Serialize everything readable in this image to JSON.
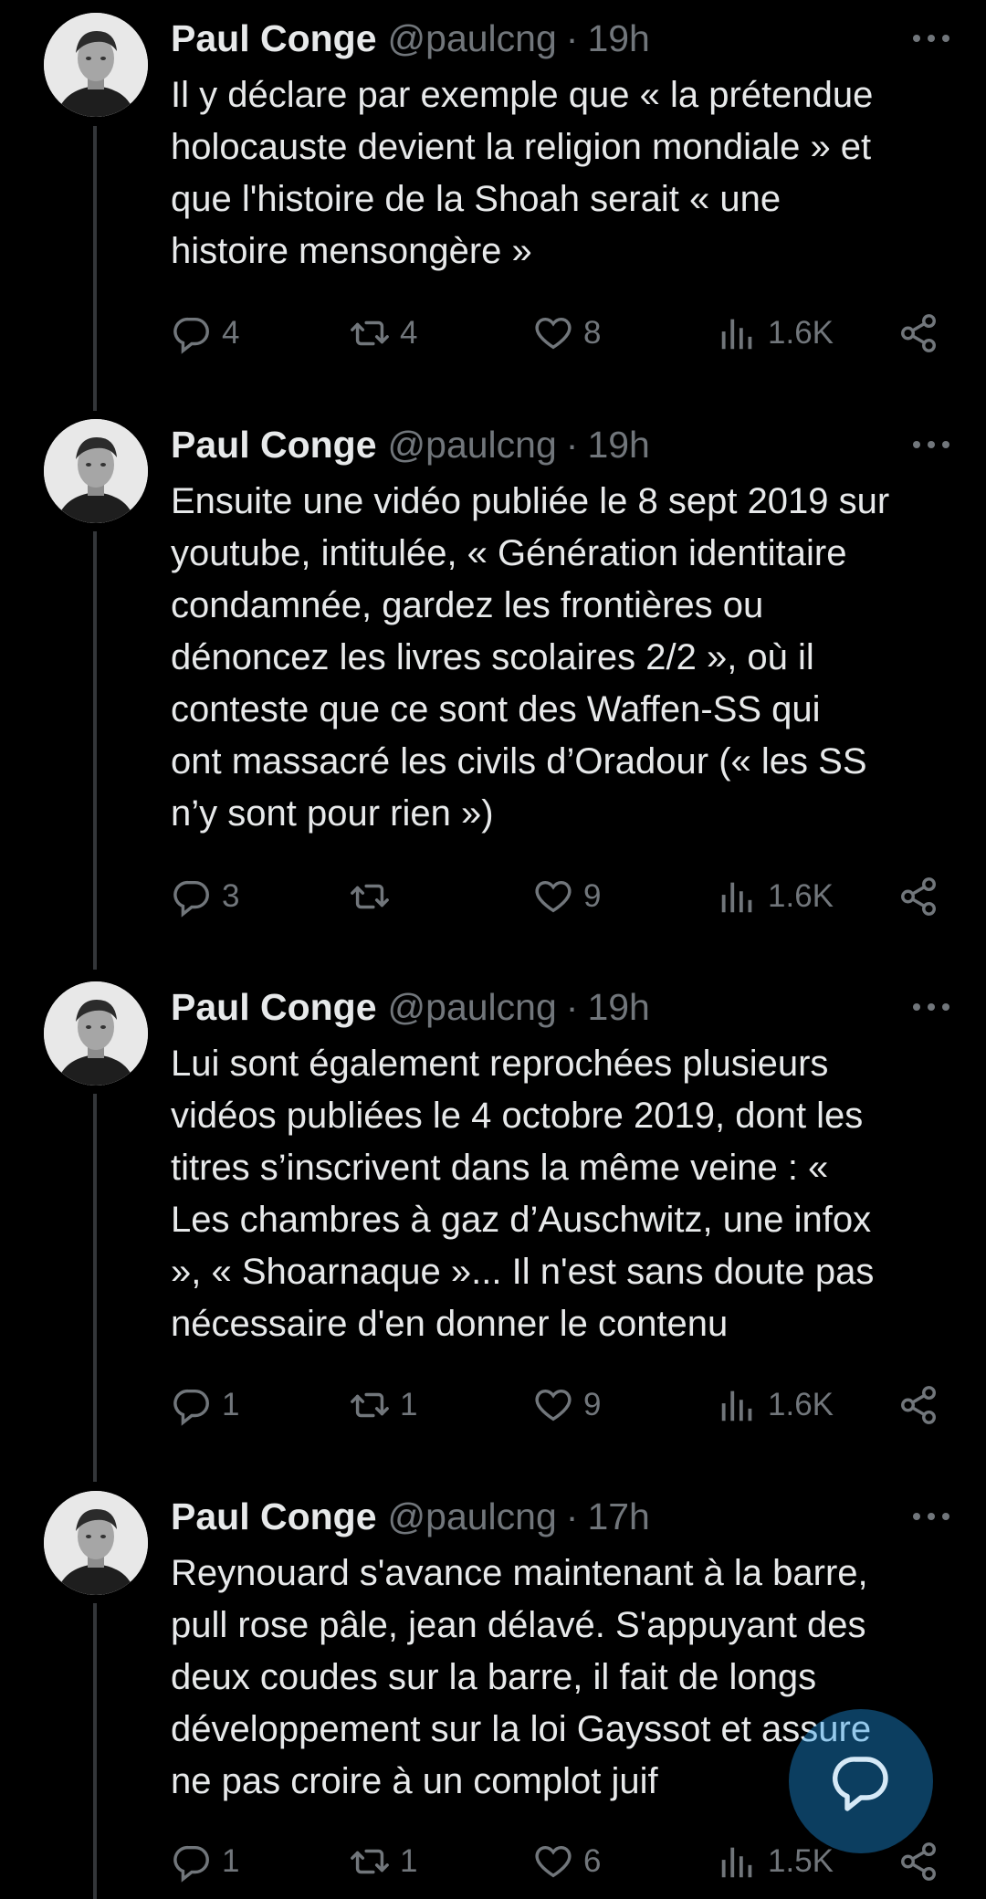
{
  "tweets": [
    {
      "name": "Paul Conge",
      "handle": "@paulcng",
      "sep": "·",
      "time": "19h",
      "text": "Il y déclare par exemple que « la prétendue\nholocauste devient la religion mondiale » et\nque l'histoire de la Shoah serait « une\nhistoire mensongère »",
      "replies": "4",
      "retweets": "4",
      "likes": "8",
      "views": "1.6K"
    },
    {
      "name": "Paul Conge",
      "handle": "@paulcng",
      "sep": "·",
      "time": "19h",
      "text": "Ensuite une vidéo publiée le 8 sept 2019 sur\nyoutube, intitulée, « Génération identitaire\ncondamnée, gardez les frontières ou\ndénoncez les livres scolaires 2/2 », où il\nconteste que ce sont des Waffen-SS qui\nont massacré les civils d’Oradour (« les SS\nn’y sont pour rien »)",
      "replies": "3",
      "retweets": "",
      "likes": "9",
      "views": "1.6K"
    },
    {
      "name": "Paul Conge",
      "handle": "@paulcng",
      "sep": "·",
      "time": "19h",
      "text": "Lui sont également reprochées plusieurs\nvidéos publiées le 4 octobre 2019, dont les\ntitres s’inscrivent dans la même veine : «\nLes chambres à gaz d’Auschwitz, une infox\n», « Shoarnaque »... Il n'est sans doute pas\nnécessaire d'en donner le contenu",
      "replies": "1",
      "retweets": "1",
      "likes": "9",
      "views": "1.6K"
    },
    {
      "name": "Paul Conge",
      "handle": "@paulcng",
      "sep": "·",
      "time": "17h",
      "text": "Reynouard s'avance maintenant à la barre,\npull rose pâle, jean délavé. S'appuyant des\ndeux coudes sur la barre, il fait de longs\ndéveloppement sur la loi Gayssot et assure\nne pas croire à un complot juif",
      "replies": "1",
      "retweets": "1",
      "likes": "6",
      "views": "1.5K"
    }
  ],
  "icons": {
    "reply": "reply-icon",
    "retweet": "retweet-icon",
    "like": "heart-icon",
    "views": "views-icon",
    "share": "share-icon",
    "more": "more-icon",
    "compose": "compose-reply-icon"
  },
  "colors": {
    "background": "#000000",
    "text": "#e7e9ea",
    "muted": "#71767b",
    "thread_line": "#333639",
    "accent": "#1d9bf0"
  }
}
